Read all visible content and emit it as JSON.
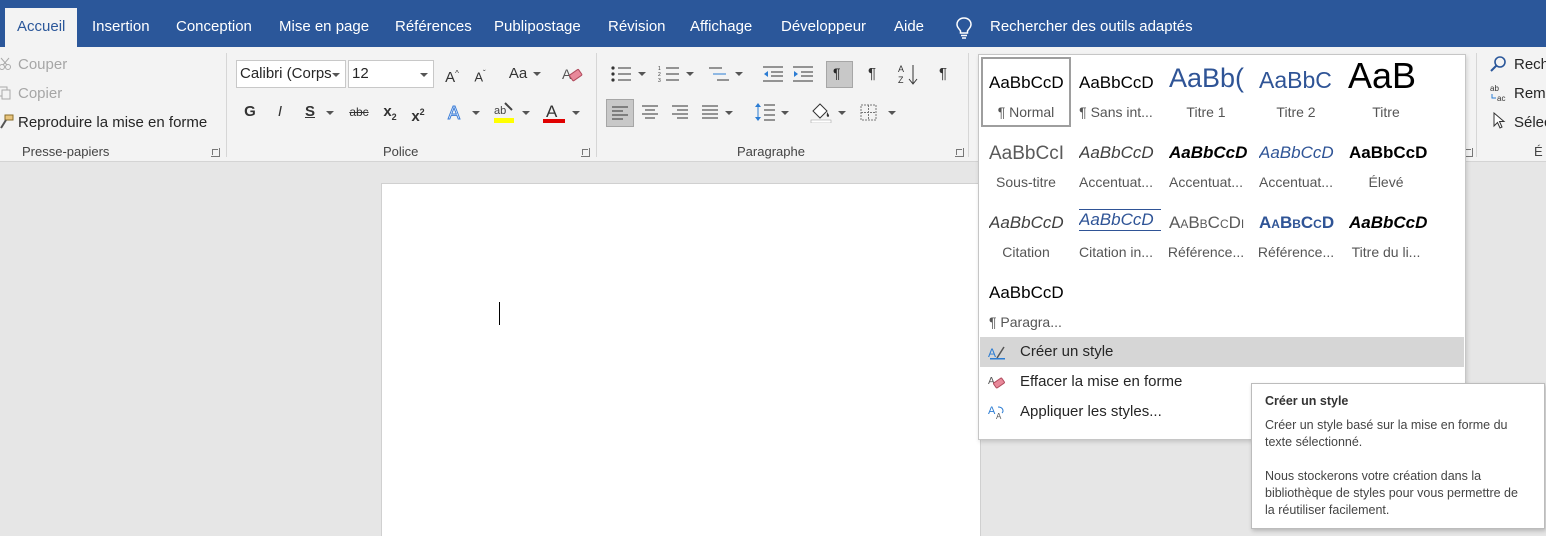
{
  "tabs": [
    "Accueil",
    "Insertion",
    "Conception",
    "Mise en page",
    "Références",
    "Publipostage",
    "Révision",
    "Affichage",
    "Développeur",
    "Aide"
  ],
  "tell_me": "Rechercher des outils adaptés",
  "clipboard": {
    "cut": "Couper",
    "copy": "Copier",
    "format_painter": "Reproduire la mise en forme",
    "label": "Presse-papiers"
  },
  "font": {
    "name": "Calibri (Corps",
    "size": "12",
    "grow": "A",
    "shrink": "A",
    "case": "Aa",
    "bold": "G",
    "italic": "I",
    "underline": "S",
    "strike": "abc",
    "subscript": "x",
    "superscript": "x",
    "label": "Police",
    "highlight_color": "#ffff00",
    "font_color": "#e00000"
  },
  "paragraph": {
    "label": "Paragraphe",
    "pilcrow": "¶"
  },
  "styles": [
    {
      "preview": "AaBbCcD",
      "name": "¶ Normal"
    },
    {
      "preview": "AaBbCcD",
      "name": "¶ Sans int..."
    },
    {
      "preview": "AaBb(",
      "name": "Titre 1"
    },
    {
      "preview": "AaBbC",
      "name": "Titre 2"
    },
    {
      "preview": "AaB",
      "name": "Titre"
    },
    {
      "preview": "AaBbCcI",
      "name": "Sous-titre"
    },
    {
      "preview": "AaBbCcD",
      "name": "Accentuat..."
    },
    {
      "preview": "AaBbCcD",
      "name": "Accentuat..."
    },
    {
      "preview": "AaBbCcD",
      "name": "Accentuat..."
    },
    {
      "preview": "AaBbCcD",
      "name": "Élevé"
    },
    {
      "preview": "AaBbCcD",
      "name": "Citation"
    },
    {
      "preview": "AaBbCcD",
      "name": "Citation in..."
    },
    {
      "preview": "AaBbCcDı",
      "name": "Référence..."
    },
    {
      "preview": "AaBbCcD",
      "name": "Référence..."
    },
    {
      "preview": "AaBbCcD",
      "name": "Titre du li..."
    },
    {
      "preview": "AaBbCcD",
      "name": "¶ Paragra..."
    }
  ],
  "gallery_menu": [
    "Créer un style",
    "Effacer la mise en forme",
    "Appliquer les styles..."
  ],
  "editing": {
    "find": "Rech",
    "replace": "Remp",
    "select": "Sélec",
    "label": "É"
  },
  "tooltip": {
    "title": "Créer un style",
    "p1": "Créer un style basé sur la mise en forme du texte sélectionné.",
    "p2": "Nous stockerons votre création dans la bibliothèque de styles pour vous permettre de la réutiliser facilement."
  },
  "colors": {
    "accent": "#2b579a",
    "heading_blue": "#2f5496"
  }
}
